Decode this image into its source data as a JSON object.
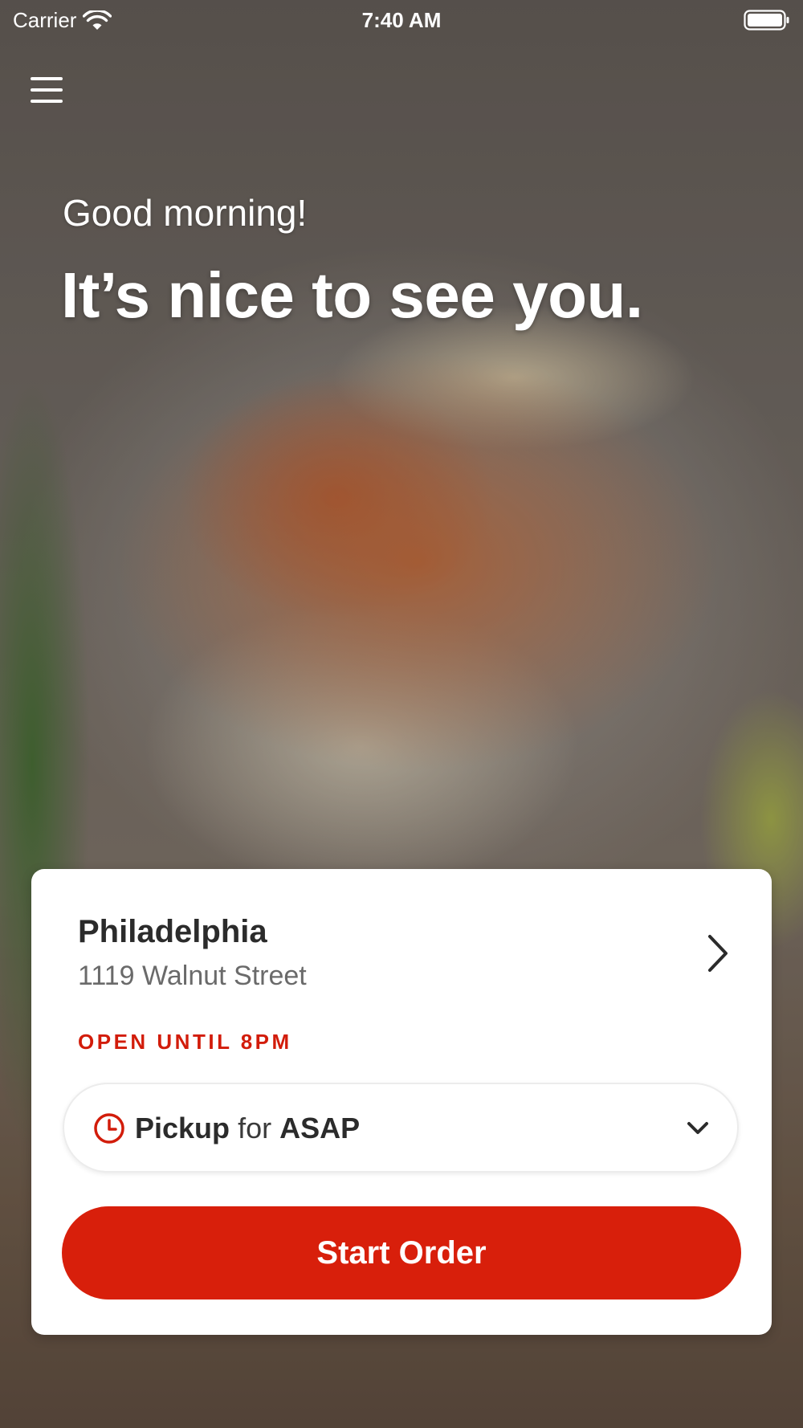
{
  "status_bar": {
    "carrier": "Carrier",
    "time": "7:40 AM"
  },
  "greeting": {
    "subtitle": "Good morning!",
    "headline": "It’s nice to see you."
  },
  "location": {
    "name": "Philadelphia",
    "address": "1119 Walnut Street",
    "status": "OPEN UNTIL 8PM"
  },
  "order_mode": {
    "mode": "Pickup",
    "connector": "for",
    "time": "ASAP"
  },
  "start_order_label": "Start Order",
  "icons": {
    "menu": "hamburger-menu-icon",
    "wifi": "wifi-icon",
    "battery": "battery-icon",
    "location_arrow": "chevron-right-icon",
    "order_time": "clock-icon",
    "dropdown": "chevron-down-icon"
  },
  "colors": {
    "accent": "#d81f0b",
    "status_open": "#d21c0a",
    "card_background": "#ffffff"
  }
}
